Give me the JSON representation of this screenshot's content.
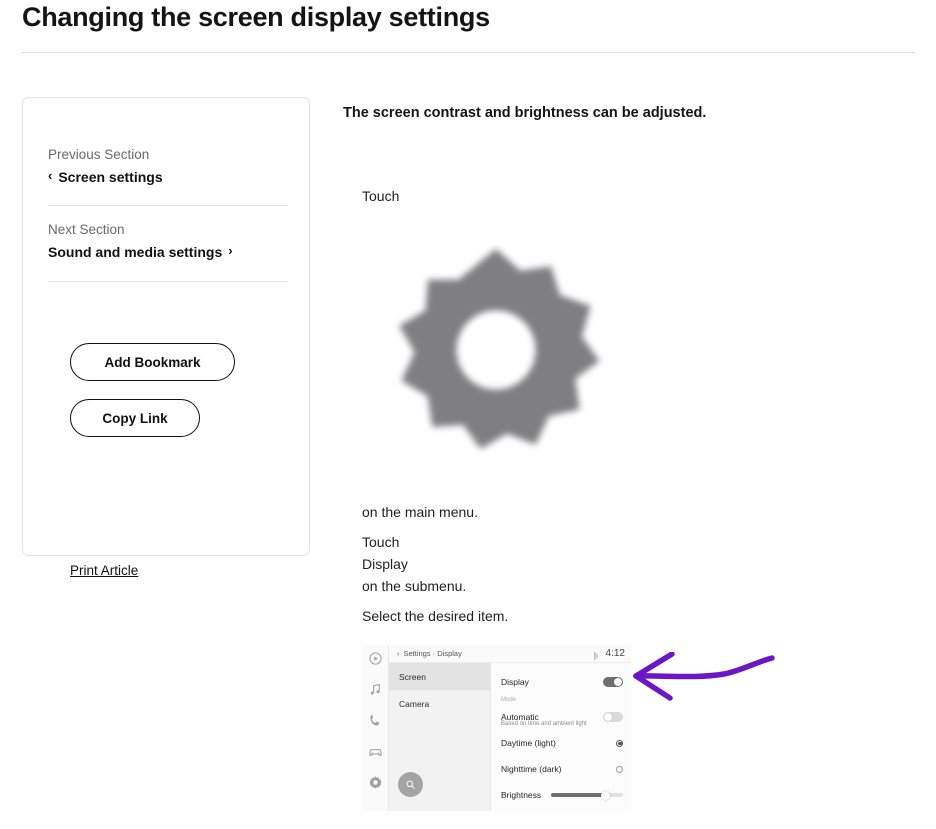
{
  "page": {
    "title": "Changing the screen display settings"
  },
  "sidebar": {
    "previous": {
      "eyebrow": "Previous Section",
      "label": "Screen settings",
      "icon": "chevron-left-icon",
      "chevron": "‹"
    },
    "next": {
      "eyebrow": "Next Section",
      "label": "Sound and media settings",
      "icon": "chevron-right-icon",
      "chevron": "›"
    },
    "add_bookmark_label": "Add Bookmark",
    "copy_link_label": "Copy Link",
    "print_article_label": "Print Article"
  },
  "main": {
    "lead": "The screen contrast and brightness can be adjusted.",
    "touch_main": "Touch",
    "gear_icon_name": "settings-gear-icon",
    "on_main_menu": "on the main menu.",
    "touch_sub": "Touch",
    "display_item": "Display",
    "on_submenu": "on the submenu.",
    "select_item": "Select the desired item."
  },
  "screenshot": {
    "breadcrumb_back": "‹",
    "breadcrumb": "Settings · Display",
    "clock": "4:12",
    "bluetooth_icon": "bluetooth-icon",
    "rail_icons": [
      "media-play-icon",
      "music-note-icon",
      "phone-icon",
      "car-icon",
      "settings-gear-icon"
    ],
    "list": [
      {
        "label": "Screen",
        "selected": true
      },
      {
        "label": "Camera",
        "selected": false
      }
    ],
    "rows": [
      {
        "label": "Display",
        "control": "toggle",
        "state": "on"
      },
      {
        "label": "Mode",
        "control": "caption"
      },
      {
        "label": "Automatic",
        "sub": "Based on time and ambient light",
        "control": "toggle",
        "state": "off"
      },
      {
        "label": "Daytime (light)",
        "control": "radio",
        "state": "checked"
      },
      {
        "label": "Nighttime (dark)",
        "control": "radio",
        "state": "unchecked"
      },
      {
        "label": "Brightness",
        "control": "slider",
        "value": 74
      }
    ],
    "search_button_icon": "search-icon"
  },
  "annotation": {
    "arrow_icon": "hand-drawn-arrow-left-icon",
    "color": "#6B17C8"
  },
  "colors": {
    "accent_purple": "#6B17C8",
    "gear_gray": "#7E7E83",
    "text": "#1a1a1a",
    "muted": "#6a6a6a",
    "border": "#e2e2e2"
  }
}
